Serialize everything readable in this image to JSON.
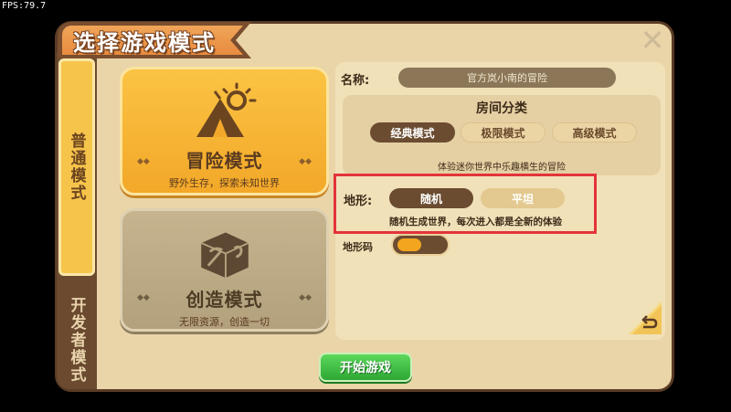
{
  "fps": "FPS:79.7",
  "title": "选择游戏模式",
  "tabs": [
    {
      "label": "普通模式",
      "active": true
    },
    {
      "label": "开发者模式",
      "active": false
    }
  ],
  "modes": [
    {
      "name": "冒险模式",
      "desc": "野外生存，探索未知世界",
      "icon": "tent-sun-icon",
      "selected": true
    },
    {
      "name": "创造模式",
      "desc": "无限资源，创造一切",
      "icon": "pickaxe-box-icon",
      "selected": false
    }
  ],
  "settings": {
    "name_label": "名称:",
    "world_name": "官方岚小南的冒险",
    "room_category_title": "房间分类",
    "room_options": [
      "经典模式",
      "极限模式",
      "高级模式"
    ],
    "room_selected": "经典模式",
    "room_desc": "体验迷你世界中乐趣横生的冒险",
    "terrain_label": "地形:",
    "terrain_options": [
      "随机",
      "平坦"
    ],
    "terrain_selected": "随机",
    "terrain_desc": "随机生成世界，每次进入都是全新的体验",
    "seed_label": "地形码"
  },
  "start_button": "开始游戏",
  "colors": {
    "accent": "#f3a829",
    "highlight": "#e3343a",
    "start": "#2ea734"
  }
}
